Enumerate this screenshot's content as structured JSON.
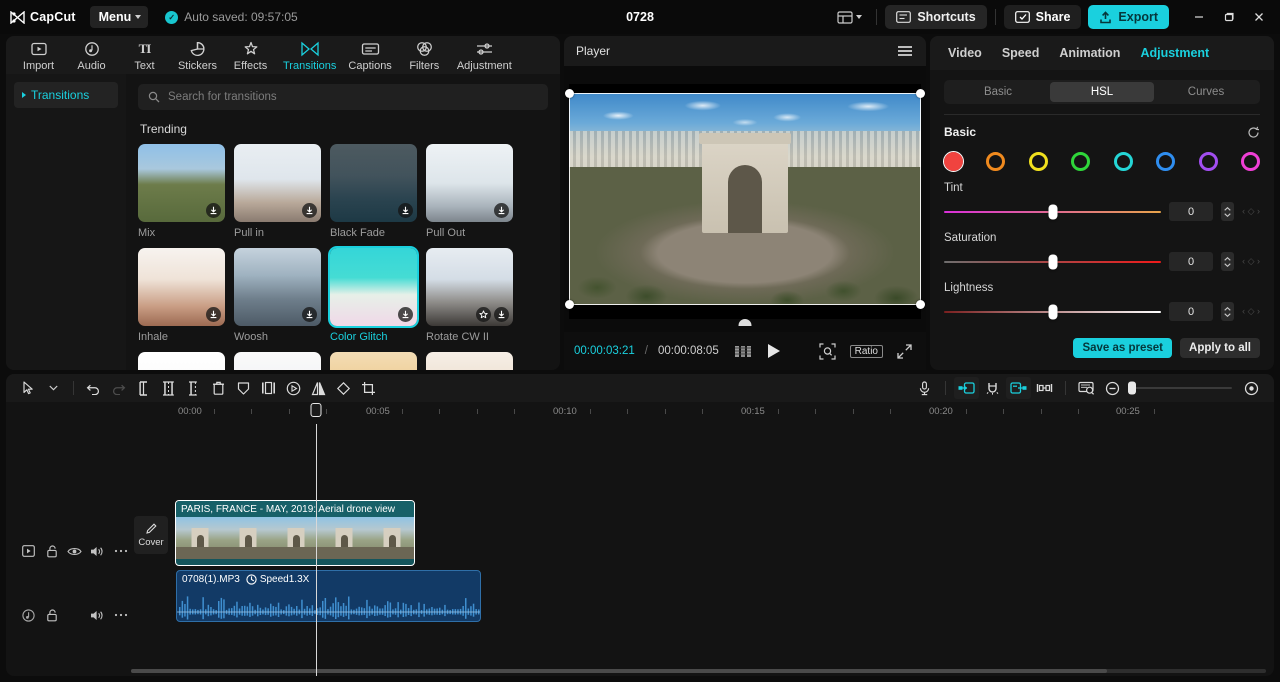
{
  "titlebar": {
    "brand": "CapCut",
    "menu_label": "Menu",
    "autosave": "Auto saved: 09:57:05",
    "project_title": "0728",
    "layout_icon": "layout-icon",
    "shortcuts_label": "Shortcuts",
    "share_label": "Share",
    "export_label": "Export",
    "minimize": "minimize-icon",
    "maximize": "maximize-icon",
    "close": "close-icon"
  },
  "library": {
    "tabs": [
      {
        "label": "Import",
        "icon": "import-icon",
        "active": false
      },
      {
        "label": "Audio",
        "icon": "audio-icon",
        "active": false
      },
      {
        "label": "Text",
        "icon": "text-icon",
        "active": false
      },
      {
        "label": "Stickers",
        "icon": "stickers-icon",
        "active": false
      },
      {
        "label": "Effects",
        "icon": "effects-icon",
        "active": false
      },
      {
        "label": "Transitions",
        "icon": "transitions-icon",
        "active": true
      },
      {
        "label": "Captions",
        "icon": "captions-icon",
        "active": false
      },
      {
        "label": "Filters",
        "icon": "filters-icon",
        "active": false
      },
      {
        "label": "Adjustment",
        "icon": "adjustment-icon",
        "active": false
      }
    ],
    "nav_item": "Transitions",
    "search_placeholder": "Search for transitions",
    "section_title": "Trending",
    "items": [
      {
        "label": "Mix",
        "download": true,
        "favorite": false,
        "selected": false
      },
      {
        "label": "Pull in",
        "download": true,
        "favorite": false,
        "selected": false
      },
      {
        "label": "Black Fade",
        "download": true,
        "favorite": false,
        "selected": false
      },
      {
        "label": "Pull Out",
        "download": true,
        "favorite": false,
        "selected": false
      },
      {
        "label": "Inhale",
        "download": true,
        "favorite": false,
        "selected": false
      },
      {
        "label": "Woosh",
        "download": true,
        "favorite": false,
        "selected": false
      },
      {
        "label": "Color Glitch",
        "download": true,
        "favorite": false,
        "selected": true
      },
      {
        "label": "Rotate CW II",
        "download": true,
        "favorite": true,
        "selected": false
      }
    ]
  },
  "player": {
    "title": "Player",
    "menu_icon": "hamburger-icon",
    "current_time": "00:00:03:21",
    "time_separator": "/",
    "total_time": "00:00:08:05",
    "frames_icon": "frames-icon",
    "play_icon": "play-icon",
    "magnify_icon": "magnify-icon",
    "ratio_label": "Ratio",
    "fullscreen_icon": "fullscreen-icon"
  },
  "inspector": {
    "tabs": [
      {
        "label": "Video",
        "active": false
      },
      {
        "label": "Speed",
        "active": false
      },
      {
        "label": "Animation",
        "active": false
      },
      {
        "label": "Adjustment",
        "active": true
      }
    ],
    "segments": [
      {
        "label": "Basic",
        "active": false
      },
      {
        "label": "HSL",
        "active": true
      },
      {
        "label": "Curves",
        "active": false
      }
    ],
    "section_label": "Basic",
    "reset_icon": "reset-icon",
    "swatches": [
      {
        "name": "red",
        "color": "#f0433f",
        "selected": true
      },
      {
        "name": "orange",
        "color": "#f08a1e",
        "selected": false
      },
      {
        "name": "yellow",
        "color": "#f0e01e",
        "selected": false
      },
      {
        "name": "green",
        "color": "#2fd63a",
        "selected": false
      },
      {
        "name": "cyan",
        "color": "#25d6d6",
        "selected": false
      },
      {
        "name": "blue",
        "color": "#2f8ef0",
        "selected": false
      },
      {
        "name": "purple",
        "color": "#a24ef0",
        "selected": false
      },
      {
        "name": "magenta",
        "color": "#f03fd6",
        "selected": false
      }
    ],
    "controls": [
      {
        "label": "Tint",
        "value": "0",
        "knob_pct": 50,
        "grad": "linear-gradient(90deg,#d92fd9,#e8a44a)"
      },
      {
        "label": "Saturation",
        "value": "0",
        "knob_pct": 50,
        "grad": "linear-gradient(90deg,#6e6e6e,#f01a1a)"
      },
      {
        "label": "Lightness",
        "value": "0",
        "knob_pct": 50,
        "grad": "linear-gradient(90deg,#7a1f1f,#ffffff)"
      }
    ],
    "save_preset_label": "Save as preset",
    "apply_all_label": "Apply to all"
  },
  "timeline": {
    "tools_left": [
      {
        "name": "select-tool-icon",
        "state": "normal"
      },
      {
        "name": "chevron-down-icon",
        "state": "normal"
      },
      {
        "name": "undo-icon",
        "state": "normal"
      },
      {
        "name": "redo-icon",
        "state": "disabled"
      },
      {
        "name": "split-icon",
        "state": "normal"
      },
      {
        "name": "trim-left-icon",
        "state": "normal"
      },
      {
        "name": "trim-right-icon",
        "state": "normal"
      },
      {
        "name": "delete-icon",
        "state": "normal"
      },
      {
        "name": "mask-icon",
        "state": "normal"
      },
      {
        "name": "freeze-frame-icon",
        "state": "normal"
      },
      {
        "name": "reverse-icon",
        "state": "normal"
      },
      {
        "name": "mirror-icon",
        "state": "normal"
      },
      {
        "name": "rotate-icon",
        "state": "normal"
      },
      {
        "name": "crop-icon",
        "state": "normal"
      }
    ],
    "tools_right": [
      {
        "name": "microphone-icon",
        "state": "normal"
      },
      {
        "name": "auto-snap-in-icon",
        "state": "active"
      },
      {
        "name": "magnet-snap-icon",
        "state": "normal"
      },
      {
        "name": "auto-snap-out-icon",
        "state": "active"
      },
      {
        "name": "link-clips-icon",
        "state": "normal"
      },
      {
        "name": "preview-zoom-icon",
        "state": "normal"
      },
      {
        "name": "zoom-out-icon",
        "state": "normal"
      },
      {
        "name": "zoom-in-icon",
        "state": "normal"
      }
    ],
    "zoom_knob_pct": 0,
    "ruler_labels": [
      "00:00",
      "00:05",
      "00:10",
      "00:15",
      "00:20",
      "00:25"
    ],
    "cover_label": "Cover",
    "video_track": {
      "icons": [
        "video-track-icon",
        "lock-icon",
        "eye-icon",
        "speaker-icon",
        "more-options-icon"
      ],
      "clip_label": "PARIS, FRANCE - MAY, 2019: Aerial drone view"
    },
    "audio_track": {
      "icons": [
        "audio-track-icon",
        "lock-icon",
        "speaker-icon",
        "more-options-icon"
      ],
      "clip_name": "0708(1).MP3",
      "clip_speed": "Speed1.3X",
      "speed_icon": "speed-icon"
    }
  }
}
